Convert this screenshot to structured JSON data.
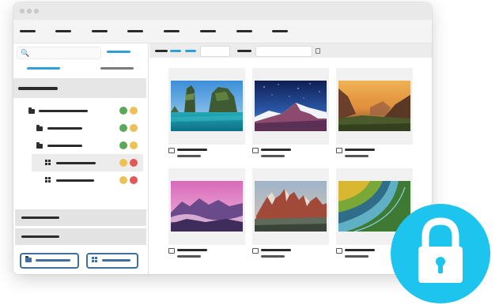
{
  "window": {
    "controls": [
      "close",
      "minimize",
      "maximize"
    ]
  },
  "menubar": {
    "items": [
      "menu-1",
      "menu-2",
      "menu-3",
      "menu-4",
      "menu-5",
      "menu-6",
      "menu-7",
      "menu-8"
    ]
  },
  "sidebar": {
    "search_icon": "🔍",
    "tabs": [
      {
        "state": "active"
      },
      {
        "state": "inactive"
      }
    ],
    "tree": [
      {
        "type": "folder",
        "indent": 0,
        "status": [
          "#5aa95a",
          "#ecc258"
        ]
      },
      {
        "type": "folder",
        "indent": 1,
        "status": [
          "#5aa95a",
          "#ecc258"
        ]
      },
      {
        "type": "folder",
        "indent": 1,
        "status": [
          "#5aa95a",
          "#ecc258"
        ]
      },
      {
        "type": "grid",
        "indent": 1,
        "selected": true,
        "status": [
          "#ecc258",
          "#e0585a"
        ]
      },
      {
        "type": "grid",
        "indent": 1,
        "status": [
          "#ecc258",
          "#e0585a"
        ]
      }
    ],
    "sections": [
      "section-1",
      "section-2"
    ],
    "buttons": [
      "folder-button",
      "grid-button"
    ]
  },
  "colors": {
    "accent": "#2e9fd8",
    "button_border": "#3f6ea0",
    "lock_badge": "#1dc4ee",
    "status_green": "#5aa95a",
    "status_yellow": "#ecc258",
    "status_red": "#e0585a"
  },
  "gallery": {
    "items": [
      {
        "scene": "tropical-sea-cliffs"
      },
      {
        "scene": "starry-snow-mountain"
      },
      {
        "scene": "sunset-valley"
      },
      {
        "scene": "pink-misty-mountains"
      },
      {
        "scene": "red-rock-peaks"
      },
      {
        "scene": "aerial-rice-terraces"
      }
    ]
  },
  "lock_icon": "lock-icon"
}
